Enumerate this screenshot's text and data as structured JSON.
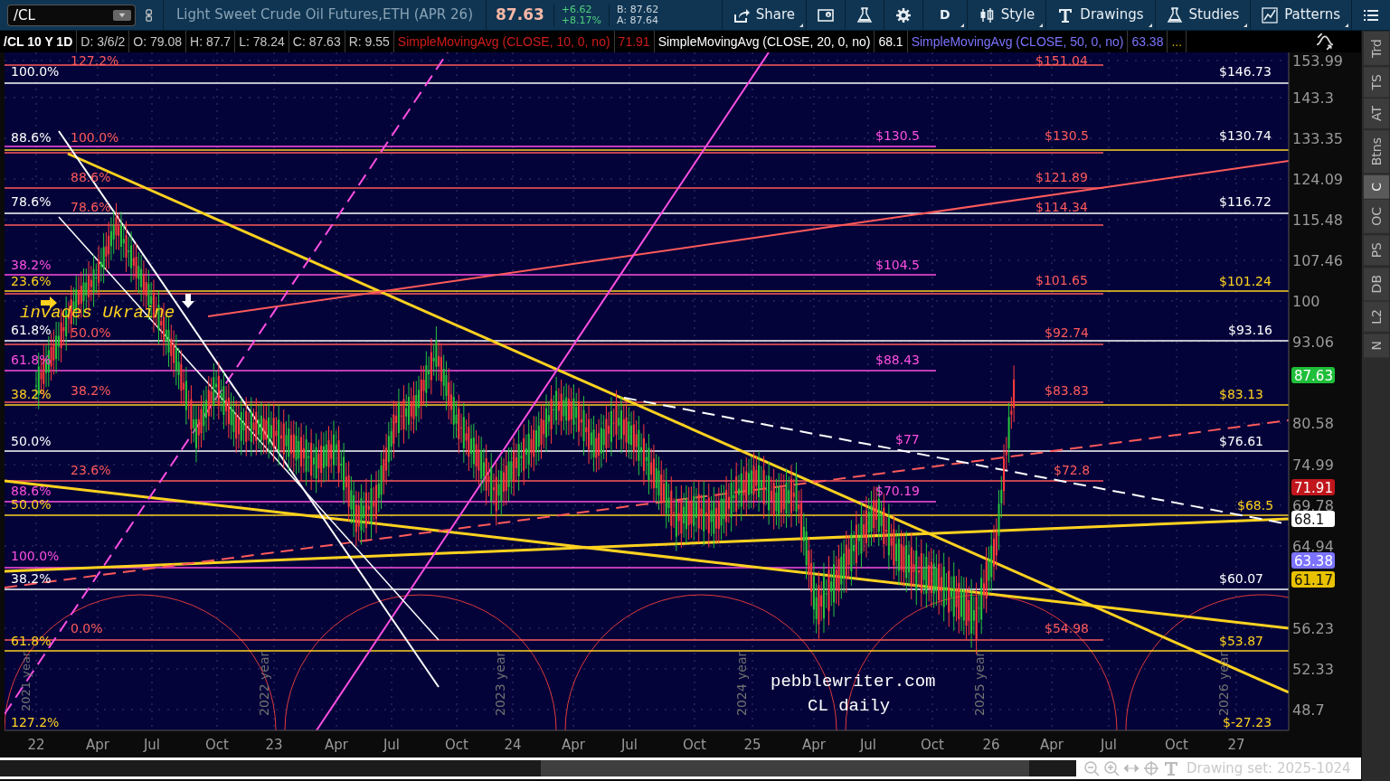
{
  "toolbar": {
    "symbol": {
      "value": "/CL"
    },
    "description": "Light Sweet Crude Oil Futures,ETH (APR 26)",
    "last": "87.63",
    "change": "+6.62",
    "change_pct": "+8.17%",
    "bid": "B: 87.62",
    "ask": "A: 87.64",
    "buttons": [
      {
        "kind": "share",
        "label": "Share"
      },
      {
        "kind": "info"
      },
      {
        "kind": "flask"
      },
      {
        "kind": "gear"
      },
      {
        "kind": "text",
        "label": "D"
      },
      {
        "kind": "candle",
        "label": "Style"
      },
      {
        "kind": "type",
        "label": "Drawings"
      },
      {
        "kind": "flask",
        "label": "Studies"
      },
      {
        "kind": "pattern",
        "label": "Patterns"
      },
      {
        "kind": "list"
      }
    ]
  },
  "info_bar": {
    "title": "/CL 10 Y 1D",
    "fields": [
      "D: 3/6/2",
      "O: 79.08",
      "H: 87.7",
      "L: 78.24",
      "C: 87.63",
      "R: 9.55"
    ],
    "studies": [
      {
        "name": "SimpleMovingAvg (CLOSE, 10, 0, no)",
        "value": "71.91"
      },
      {
        "name": "SimpleMovingAvg (CLOSE, 20, 0, no)",
        "value": "68.1"
      },
      {
        "name": "SimpleMovingAvg (CLOSE, 50, 0, no)",
        "value": "63.38"
      }
    ],
    "more": "..."
  },
  "chart": {
    "time_axis": [
      "22",
      "Apr",
      "Jul",
      "Oct",
      "23",
      "Apr",
      "Jul",
      "Oct",
      "24",
      "Apr",
      "Jul",
      "Oct",
      "25",
      "Apr",
      "Jul",
      "Oct",
      "26",
      "Apr",
      "Jul",
      "Oct",
      "27"
    ],
    "price_axis": [
      "153.99",
      "143.3",
      "133.35",
      "124.09",
      "115.48",
      "107.46",
      "100",
      "93.06",
      "80.58",
      "74.99",
      "69.78",
      "64.94",
      "56.23",
      "52.33",
      "48.7"
    ],
    "level_labels": [
      {
        "text": "100.0%",
        "color": "#ffffff"
      },
      {
        "text": "88.6%",
        "color": "#ffffff"
      },
      {
        "text": "78.6%",
        "color": "#ffffff"
      },
      {
        "text": "38.2%",
        "color": "#ff4fe0"
      },
      {
        "text": "23.6%",
        "color": "#ffd21f"
      },
      {
        "text": "61.8%",
        "color": "#ffffff"
      },
      {
        "text": "61.8%",
        "color": "#ff4fe0"
      },
      {
        "text": "38.2%",
        "color": "#ffd21f"
      },
      {
        "text": "50.0%",
        "color": "#ffffff"
      },
      {
        "text": "88.6%",
        "color": "#ff4fe0"
      },
      {
        "text": "50.0%",
        "color": "#ffd21f"
      },
      {
        "text": "100.0%",
        "color": "#ff4fe0"
      },
      {
        "text": "38.2%",
        "color": "#ffffff"
      },
      {
        "text": "61.8%",
        "color": "#ffd21f"
      },
      {
        "text": "127.2%",
        "color": "#ffd21f"
      },
      {
        "text": "127.2%",
        "color": "#ff5a5a"
      },
      {
        "text": "100.0%",
        "color": "#ff5a5a"
      },
      {
        "text": "88.6%",
        "color": "#ff5a5a"
      },
      {
        "text": "78.6%",
        "color": "#ff5a5a"
      },
      {
        "text": "50.0%",
        "color": "#ff5a5a"
      },
      {
        "text": "38.2%",
        "color": "#ff5a5a"
      },
      {
        "text": "23.6%",
        "color": "#ff5a5a"
      },
      {
        "text": "0.0%",
        "color": "#ff5a5a"
      },
      {
        "text": "$130.5",
        "color": "#ff4fe0"
      },
      {
        "text": "$104.5",
        "color": "#ff4fe0"
      },
      {
        "text": "$88.43",
        "color": "#ff4fe0"
      },
      {
        "text": "$77",
        "color": "#ff4fe0"
      },
      {
        "text": "$70.19",
        "color": "#ff4fe0"
      },
      {
        "text": "$151.04",
        "color": "#ff5a5a"
      },
      {
        "text": "$130.5",
        "color": "#ff5a5a"
      },
      {
        "text": "$121.89",
        "color": "#ff5a5a"
      },
      {
        "text": "$114.34",
        "color": "#ff5a5a"
      },
      {
        "text": "$101.65",
        "color": "#ff5a5a"
      },
      {
        "text": "$92.74",
        "color": "#ff5a5a"
      },
      {
        "text": "$83.83",
        "color": "#ff5a5a"
      },
      {
        "text": "$72.8",
        "color": "#ff5a5a"
      },
      {
        "text": "$54.98",
        "color": "#ff5a5a"
      },
      {
        "text": "$146.73",
        "color": "#ffffff"
      },
      {
        "text": "$130.74",
        "color": "#ffffff"
      },
      {
        "text": "$116.72",
        "color": "#ffffff"
      },
      {
        "text": "$101.24",
        "color": "#ffd21f"
      },
      {
        "text": "$93.16",
        "color": "#ffffff"
      },
      {
        "text": "$83.13",
        "color": "#ffd21f"
      },
      {
        "text": "$76.61",
        "color": "#ffffff"
      },
      {
        "text": "$68.5",
        "color": "#ffd21f"
      },
      {
        "text": "$60.07",
        "color": "#ffffff"
      },
      {
        "text": "$53.87",
        "color": "#ffd21f"
      },
      {
        "text": "$-27.23",
        "color": "#ffd21f"
      }
    ],
    "notes": [
      {
        "text": "invades Ukraine",
        "color": "#ffd21f"
      },
      {
        "text": "pebblewriter.com",
        "color": "#ffffff"
      },
      {
        "text": "CL daily",
        "color": "#ffffff"
      }
    ],
    "year_labels": [
      "2021 year",
      "2022 year",
      "2023 year",
      "2024 year",
      "2025 year",
      "2026 year"
    ],
    "badges": [
      {
        "text": "87.63",
        "color": "#1fbf3a"
      },
      {
        "text": "71.91",
        "color": "#c0161c"
      },
      {
        "text": "68.1",
        "color": "#ffffff"
      },
      {
        "text": "63.38",
        "color": "#7b73ff"
      },
      {
        "text": "61.17",
        "color": "#e8c200"
      }
    ]
  },
  "side_tabs": [
    {
      "label": "Trd",
      "selected": false
    },
    {
      "label": "TS",
      "selected": false
    },
    {
      "label": "AT",
      "selected": false
    },
    {
      "label": "Btns",
      "selected": false
    },
    {
      "label": "C",
      "selected": true
    },
    {
      "label": "OC",
      "selected": false
    },
    {
      "label": "PS",
      "selected": false
    },
    {
      "label": "DB",
      "selected": false
    },
    {
      "label": "L2",
      "selected": false
    },
    {
      "label": "N",
      "selected": false
    }
  ],
  "status": {
    "drawing_set": "Drawing set: 2025-1024"
  }
}
